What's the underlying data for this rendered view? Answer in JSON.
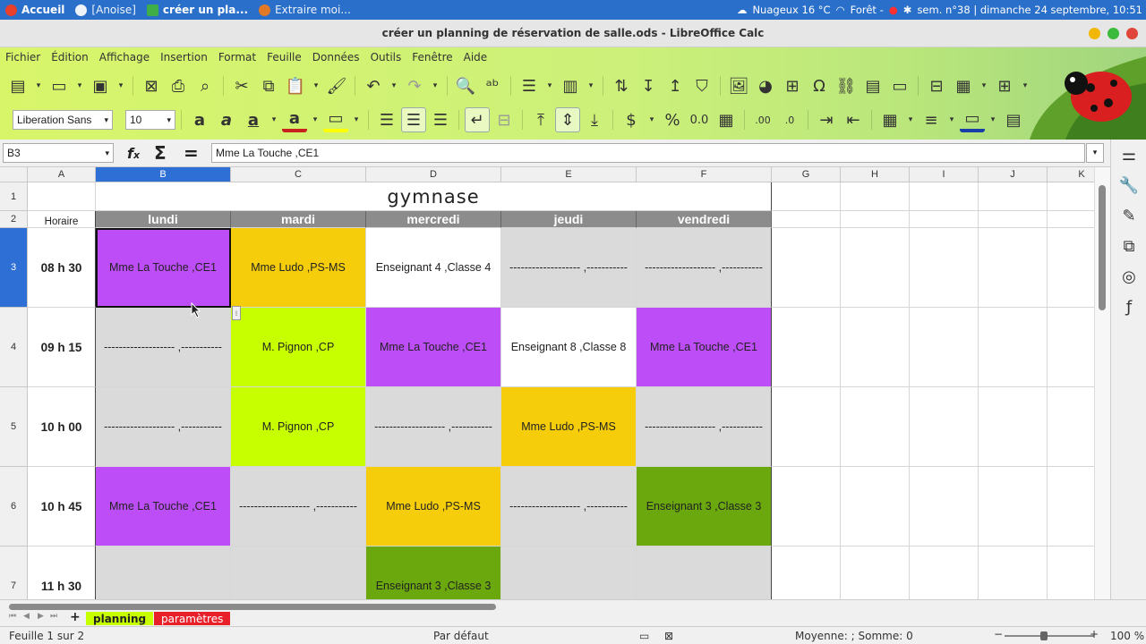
{
  "taskbar": {
    "items": [
      "Accueil",
      "[Anoise]",
      "créer un pla...",
      "Extraire moi..."
    ],
    "weather": "Nuageux 16 °C",
    "wifi": "Forêt -",
    "clock": "sem. n°38 | dimanche 24 septembre, 10:51"
  },
  "window": {
    "title": "créer un planning de réservation de salle.ods - LibreOffice Calc"
  },
  "menu": [
    "Fichier",
    "Édition",
    "Affichage",
    "Insertion",
    "Format",
    "Feuille",
    "Données",
    "Outils",
    "Fenêtre",
    "Aide"
  ],
  "format_toolbar": {
    "font_name": "Liberation Sans",
    "font_size": "10",
    "number_format": "0.0"
  },
  "formula_bar": {
    "cell_ref": "B3",
    "content": "Mme La Touche ,CE1"
  },
  "columns": [
    "A",
    "B",
    "C",
    "D",
    "E",
    "F",
    "G",
    "H",
    "I",
    "J",
    "K"
  ],
  "rows": [
    "1",
    "2",
    "3",
    "4",
    "5",
    "6",
    "7"
  ],
  "sheet": {
    "title": "gymnase",
    "time_header": "Horaire",
    "days": [
      "lundi",
      "mardi",
      "mercredi",
      "jeudi",
      "vendredi"
    ],
    "slots": [
      {
        "time": "08 h 30",
        "cells": [
          {
            "text": "Mme La Touche ,CE1",
            "color": "purple"
          },
          {
            "text": "Mme Ludo ,PS-MS",
            "color": "gold"
          },
          {
            "text": "Enseignant 4 ,Classe 4",
            "color": "white"
          },
          {
            "text": "------------------- ,-----------",
            "color": "grey"
          },
          {
            "text": "------------------- ,-----------",
            "color": "grey"
          }
        ]
      },
      {
        "time": "09 h 15",
        "cells": [
          {
            "text": "------------------- ,-----------",
            "color": "grey"
          },
          {
            "text": "M. Pignon ,CP",
            "color": "lime"
          },
          {
            "text": "Mme La Touche ,CE1",
            "color": "purple"
          },
          {
            "text": "Enseignant 8 ,Classe 8",
            "color": "white"
          },
          {
            "text": "Mme La Touche ,CE1",
            "color": "purple"
          }
        ]
      },
      {
        "time": "10 h 00",
        "cells": [
          {
            "text": "------------------- ,-----------",
            "color": "grey"
          },
          {
            "text": "M. Pignon ,CP",
            "color": "lime"
          },
          {
            "text": "------------------- ,-----------",
            "color": "grey"
          },
          {
            "text": "Mme Ludo ,PS-MS",
            "color": "gold"
          },
          {
            "text": "------------------- ,-----------",
            "color": "grey"
          }
        ]
      },
      {
        "time": "10 h 45",
        "cells": [
          {
            "text": "Mme La Touche ,CE1",
            "color": "purple"
          },
          {
            "text": "------------------- ,-----------",
            "color": "grey"
          },
          {
            "text": "Mme Ludo ,PS-MS",
            "color": "gold"
          },
          {
            "text": "------------------- ,-----------",
            "color": "grey"
          },
          {
            "text": "Enseignant 3 ,Classe 3",
            "color": "green"
          }
        ]
      },
      {
        "time": "11 h 30",
        "cells": [
          {
            "text": "",
            "color": "grey"
          },
          {
            "text": "",
            "color": "grey"
          },
          {
            "text": "Enseignant 3 ,Classe 3",
            "color": "green"
          },
          {
            "text": "",
            "color": "grey"
          },
          {
            "text": "",
            "color": "grey"
          }
        ]
      }
    ]
  },
  "sheet_tabs": [
    {
      "label": "planning",
      "color": "#c8ff00",
      "text_color": "#222"
    },
    {
      "label": "paramètres",
      "color": "#e8202a",
      "text_color": "#fff"
    }
  ],
  "statusbar": {
    "sheet_info": "Feuille 1 sur 2",
    "page_style": "Par défaut",
    "aggregate": "Moyenne: ; Somme: 0",
    "zoom": "100 %"
  },
  "colors": {
    "purple": "#bd4ef7",
    "gold": "#f6cd0b",
    "white": "#ffffff",
    "grey": "#dadada",
    "lime": "#c8ff00",
    "green": "#6aa80d",
    "selection": "#2d6fd4"
  }
}
